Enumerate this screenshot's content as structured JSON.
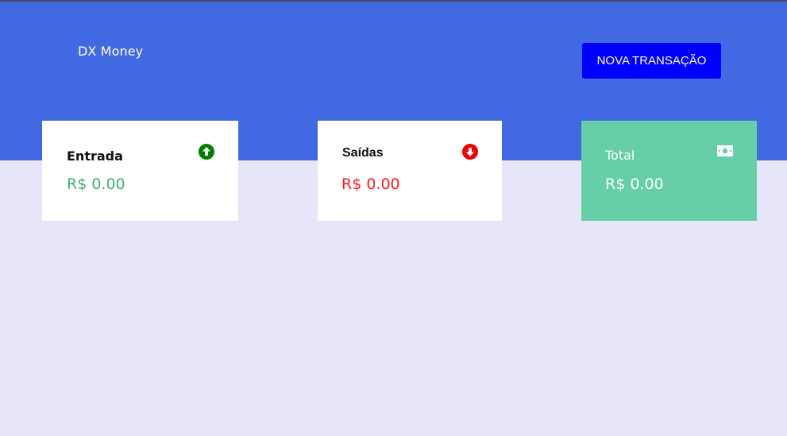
{
  "header": {
    "brand": "DX Money",
    "new_transaction_label": "NOVA TRANSAÇÃO",
    "background_color": "#4169e1",
    "button_color": "#0000ff"
  },
  "summary": {
    "income": {
      "title": "Entrada",
      "value": "R$ 0.00",
      "icon": "arrow-up-circle-icon",
      "color": "#3cb371"
    },
    "outcome": {
      "title": "Saídas",
      "value": "R$ 0.00",
      "icon": "arrow-down-circle-icon",
      "color": "#ff1a1a"
    },
    "total": {
      "title": "Total",
      "value": "R$ 0.00",
      "icon": "money-bill-icon",
      "background_color": "#66cfa8"
    }
  },
  "page": {
    "background_color": "#e6e6f8"
  }
}
